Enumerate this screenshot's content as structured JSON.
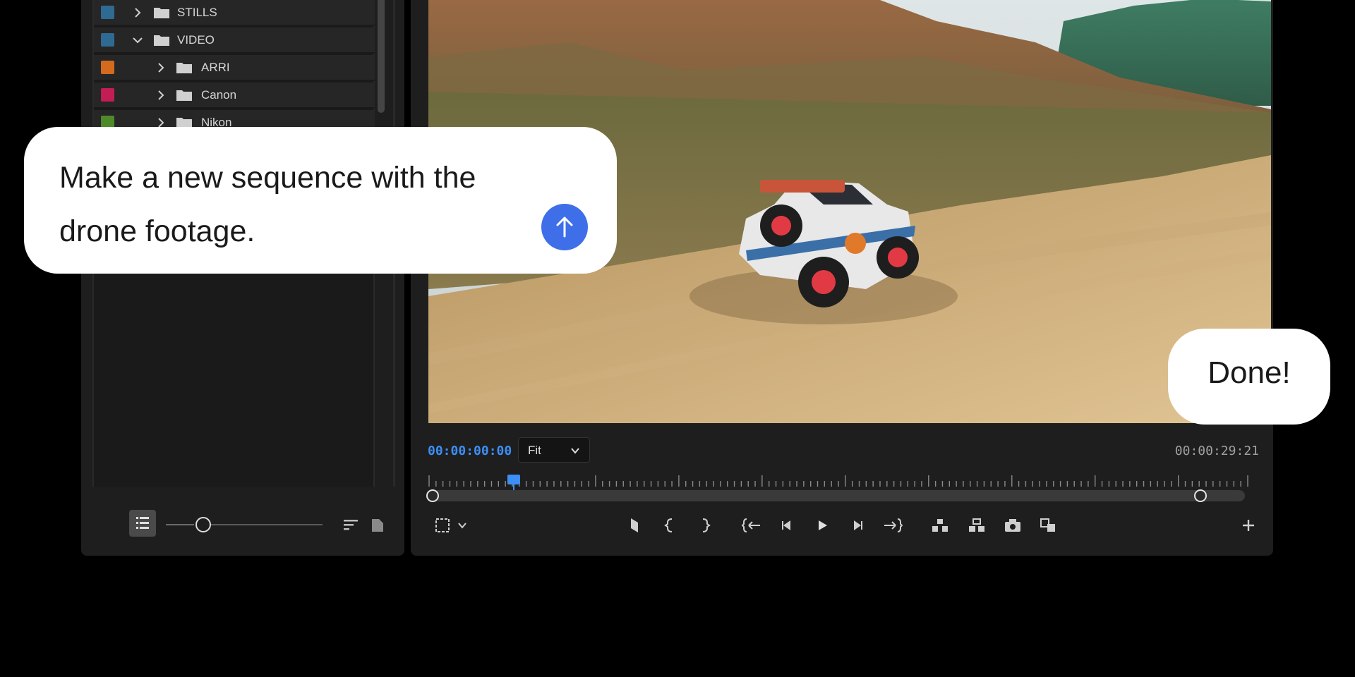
{
  "project_panel": {
    "bins": [
      {
        "label": "STILLS",
        "color": "#2f6a92",
        "expanded": false,
        "level": 0
      },
      {
        "label": "VIDEO",
        "color": "#2f6a92",
        "expanded": true,
        "level": 0
      },
      {
        "label": "ARRI",
        "color": "#d36a1e",
        "expanded": false,
        "level": 1
      },
      {
        "label": "Canon",
        "color": "#c21d55",
        "expanded": false,
        "level": 1
      },
      {
        "label": "Nikon",
        "color": "#4f8a2a",
        "expanded": false,
        "level": 1
      }
    ],
    "footer_icons": [
      "list-view-icon",
      "zoom-slider",
      "sort-icon",
      "new-bin-icon"
    ]
  },
  "monitor": {
    "timecode_current": "00:00:00:00",
    "fit_select": "Fit",
    "timecode_duration": "00:00:29:21",
    "playhead_fraction": 0.1,
    "accent": "#3d8ef5",
    "transport_icons": [
      "safe-margins-icon",
      "chevron-down-icon",
      "add-marker-icon",
      "mark-in-icon",
      "mark-out-icon",
      "go-to-in-icon",
      "step-back-icon",
      "play-icon",
      "step-forward-icon",
      "go-to-out-icon",
      "lift-icon",
      "extract-icon",
      "export-frame-icon",
      "comparison-view-icon",
      "add-button-icon"
    ]
  },
  "chat": {
    "prompt_text": "Make a new sequence with the drone footage.",
    "send_color": "#3f6fe8",
    "reply_text": "Done!"
  }
}
